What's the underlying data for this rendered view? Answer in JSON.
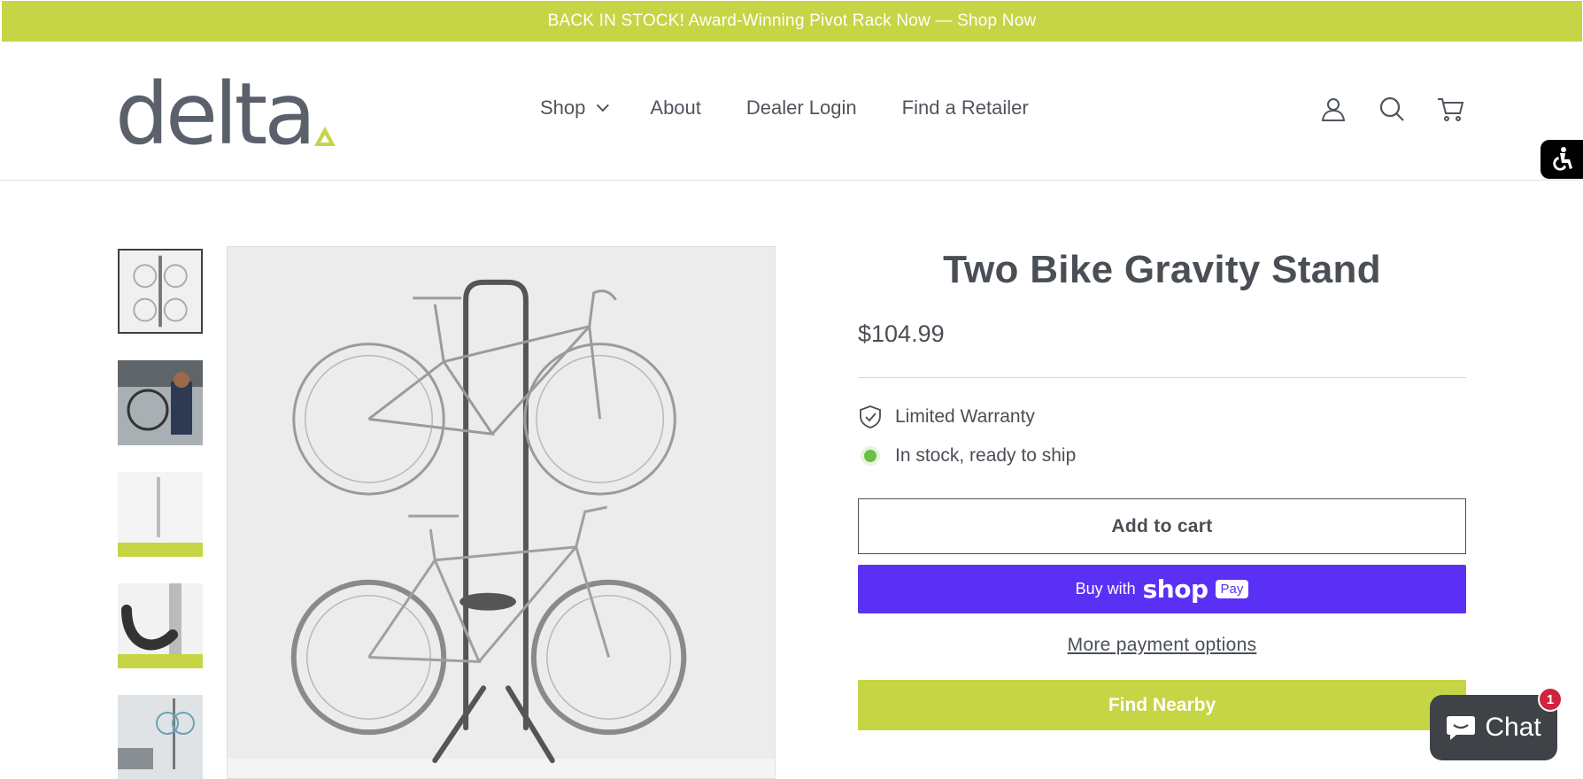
{
  "announcement": {
    "text": "BACK IN STOCK! Award-Winning Pivot Rack Now — Shop Now"
  },
  "header": {
    "logo_text": "delta",
    "nav": [
      {
        "label": "Shop",
        "has_dropdown": true
      },
      {
        "label": "About"
      },
      {
        "label": "Dealer Login"
      },
      {
        "label": "Find a Retailer"
      }
    ],
    "icons": [
      "account-icon",
      "search-icon",
      "cart-icon"
    ]
  },
  "gallery": {
    "thumbnails": [
      "two-bikes-on-stand",
      "man-hanging-bike",
      "stand-dimensions",
      "hook-closeup",
      "stand-in-room"
    ],
    "selected_index": 0
  },
  "product": {
    "title": "Two Bike Gravity Stand",
    "price": "$104.99",
    "features": [
      {
        "icon": "shield-check-icon",
        "text": "Limited Warranty"
      },
      {
        "icon": "in-stock-dot-icon",
        "text": "In stock, ready to ship"
      }
    ],
    "add_to_cart": "Add to cart",
    "buy_with_prefix": "Buy with",
    "shop_word": "shop",
    "pay_word": "Pay",
    "more_payment": "More payment options",
    "find_nearby": "Find Nearby"
  },
  "chat": {
    "label": "Chat",
    "badge": "1"
  },
  "colors": {
    "brand_lime": "#c5d546",
    "shop_pay": "#5a31f4",
    "text": "#4a4f56",
    "stock_green": "#6cc04a",
    "badge_red": "#d0233f"
  }
}
